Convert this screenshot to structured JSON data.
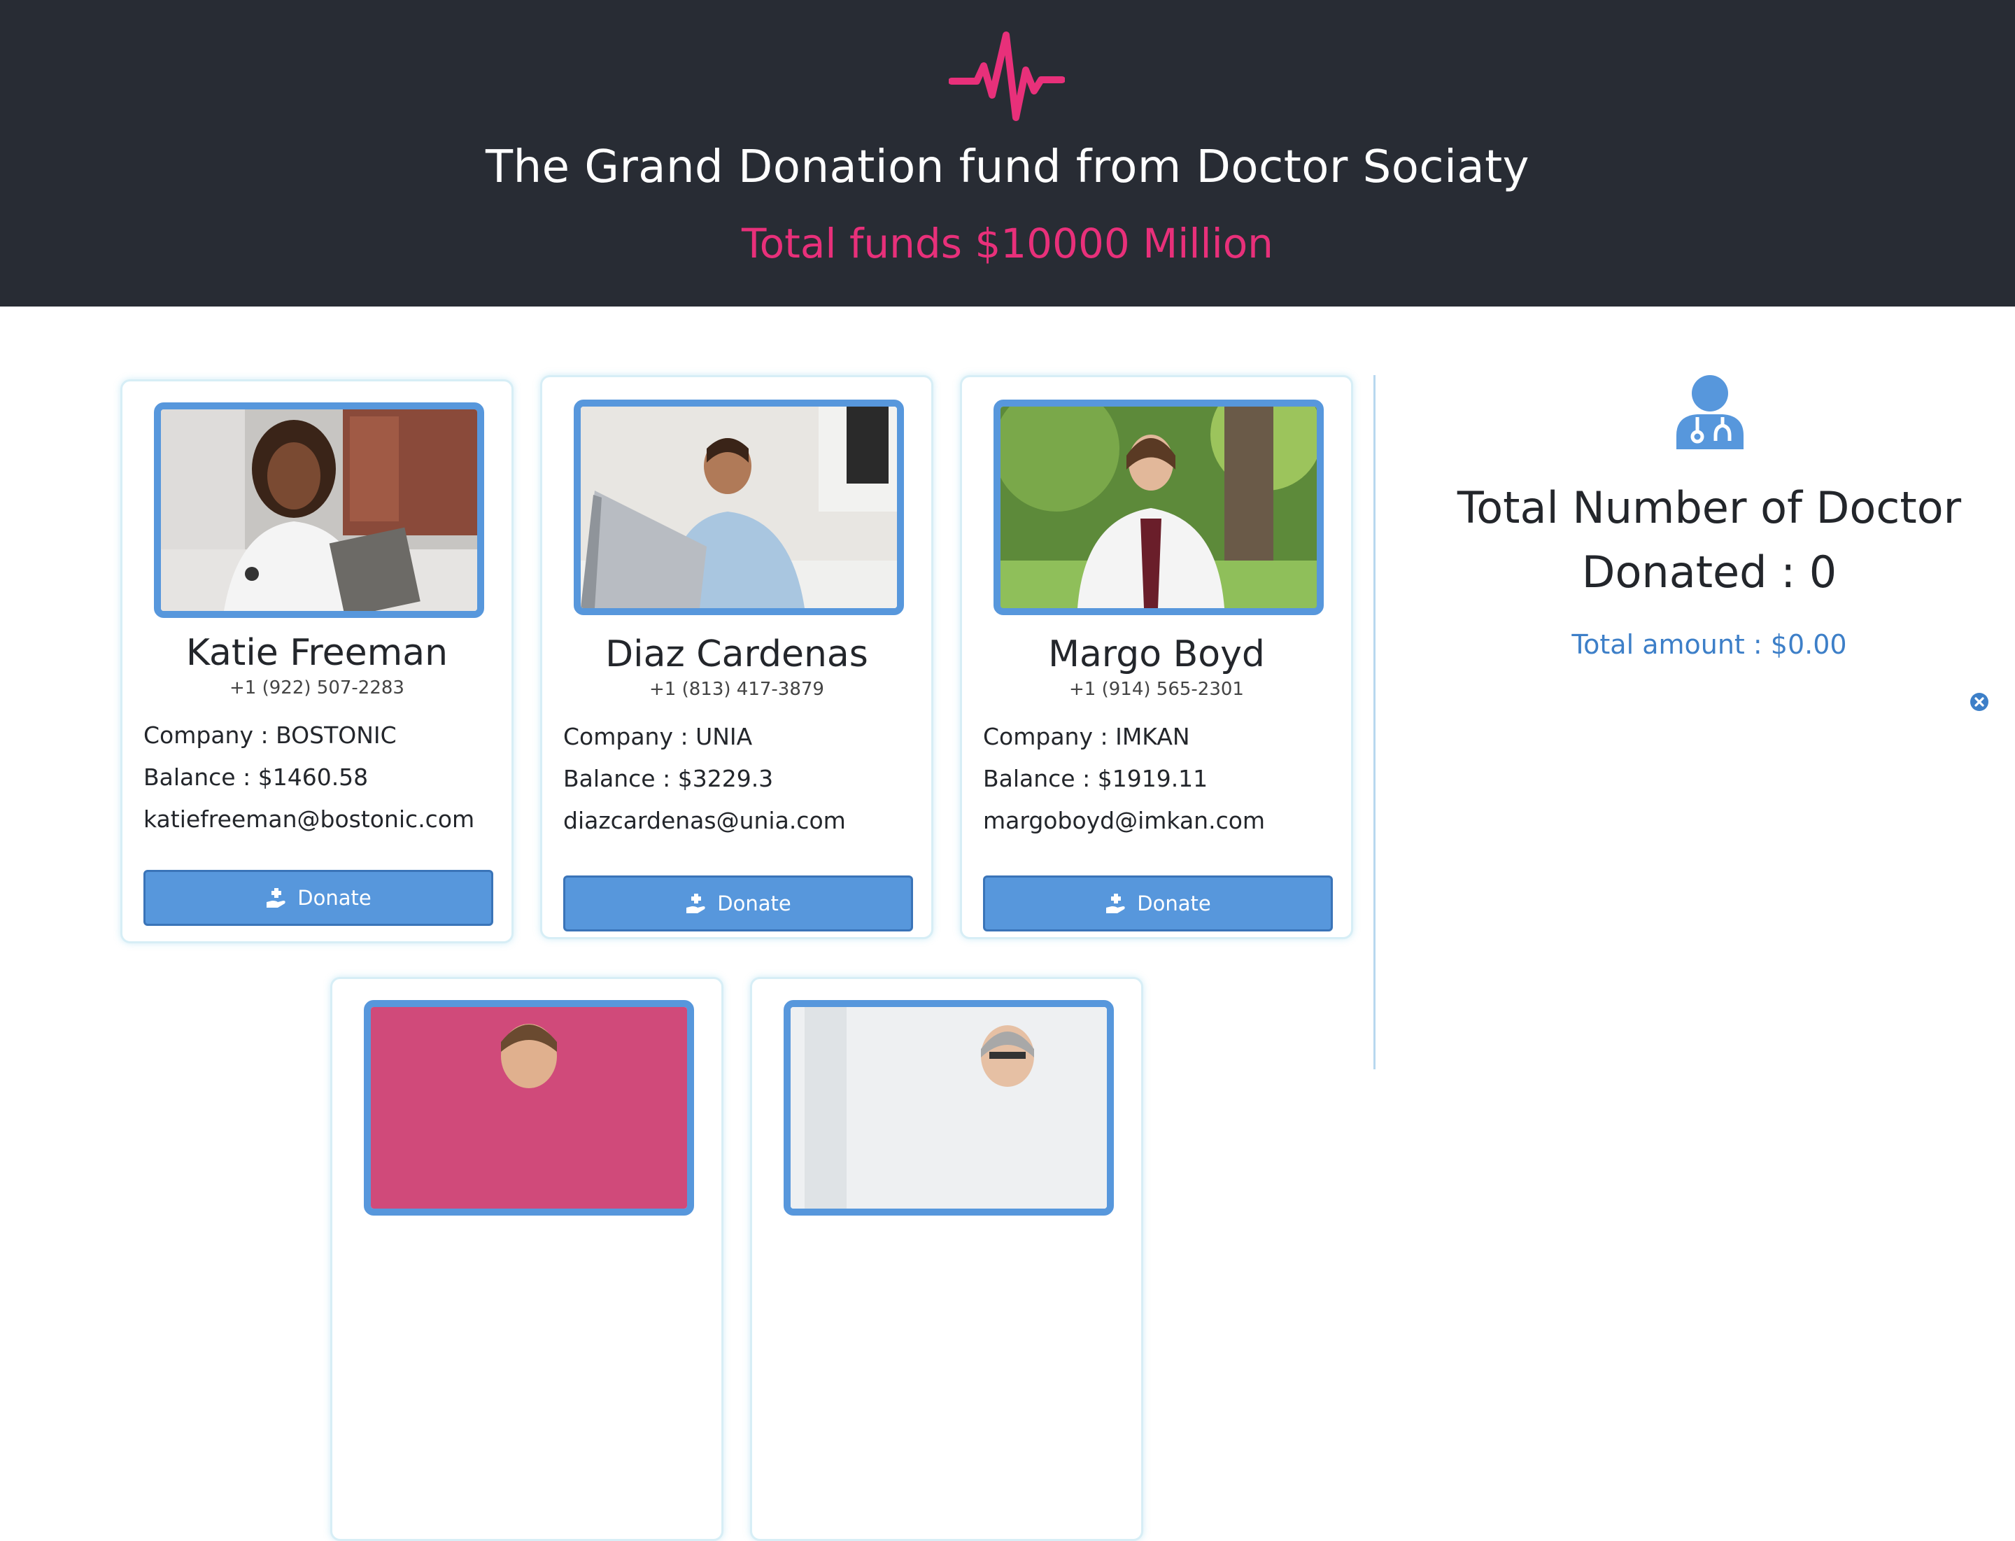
{
  "header": {
    "logo_icon": "heartbeat-pulse-icon",
    "title": "The Grand Donation fund from Doctor Sociaty",
    "total_funds": "Total funds $10000 Million"
  },
  "colors": {
    "header_bg": "#282c34",
    "accent_pink": "#e8307a",
    "primary_blue": "#5797dc",
    "link_blue": "#3d7fc8"
  },
  "doctors": [
    {
      "name": "Katie Freeman",
      "phone": "+1 (922) 507-2283",
      "company": "Company : BOSTONIC",
      "balance": "Balance : $1460.58",
      "email": "katiefreeman@bostonic.com",
      "donate_label": "Donate"
    },
    {
      "name": "Diaz Cardenas",
      "phone": "+1 (813) 417-3879",
      "company": "Company : UNIA",
      "balance": "Balance : $3229.3",
      "email": "diazcardenas@unia.com",
      "donate_label": "Donate"
    },
    {
      "name": "Margo Boyd",
      "phone": "+1 (914) 565-2301",
      "company": "Company : IMKAN",
      "balance": "Balance : $1919.11",
      "email": "margoboyd@imkan.com",
      "donate_label": "Donate"
    }
  ],
  "summary": {
    "icon": "doctor-icon",
    "total_doctors": "Total Number of Doctor Donated : 0",
    "total_amount": "Total amount : $0.00"
  }
}
